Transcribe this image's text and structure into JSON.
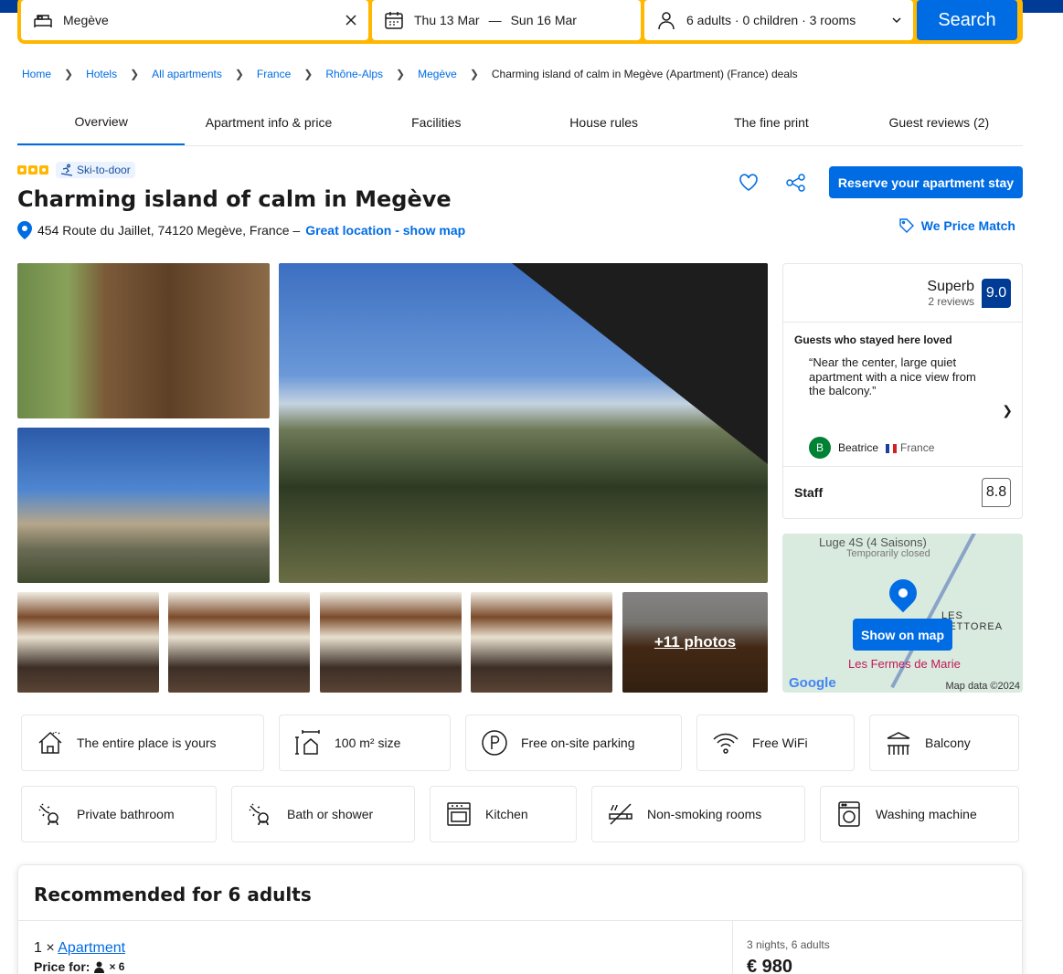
{
  "search": {
    "destination": "Megève",
    "checkin": "Thu 13 Mar",
    "dash": "—",
    "checkout": "Sun 16 Mar",
    "occupancy": "6 adults · 0 children · 3 rooms",
    "search_label": "Search"
  },
  "breadcrumb": [
    "Home",
    "Hotels",
    "All apartments",
    "France",
    "Rhône-Alps",
    "Megève"
  ],
  "breadcrumb_current": "Charming island of calm in Megève (Apartment) (France) deals",
  "tabs": [
    "Overview",
    "Apartment info & price",
    "Facilities",
    "House rules",
    "The fine print",
    "Guest reviews (2)"
  ],
  "property": {
    "badge": "Ski-to-door",
    "title": "Charming island of calm in Megève",
    "address": "454 Route du Jaillet, 74120 Megève, France –",
    "location_link": "Great location - show map",
    "reserve_label": "Reserve your apartment stay",
    "price_match": "We Price Match",
    "stars": 3
  },
  "photos": {
    "more_label": "+11 photos"
  },
  "reviews": {
    "word": "Superb",
    "count": "2 reviews",
    "score": "9.0",
    "loved_heading": "Guests who stayed here loved",
    "quote": "“Near the center, large quiet apartment with a nice view from the balcony.”",
    "reviewer_initial": "B",
    "reviewer_name": "Beatrice",
    "reviewer_country": "France",
    "staff_label": "Staff",
    "staff_score": "8.8"
  },
  "map": {
    "place1": "Luge 4S (4 Saisons)",
    "place1_status": "Temporarily closed",
    "place2": "LES PETTOREA",
    "place3": "Les Fermes de Marie",
    "google": "Google",
    "attribution": "Map data ©2024",
    "button": "Show on map"
  },
  "facilities_row1": [
    "The entire place is yours",
    "100 m² size",
    "Free on-site parking",
    "Free WiFi",
    "Balcony"
  ],
  "facilities_row2": [
    "Private bathroom",
    "Bath or shower",
    "Kitchen",
    "Non-smoking rooms",
    "Washing machine"
  ],
  "recommended": {
    "heading": "Recommended for 6 adults",
    "qty": "1 ×",
    "unit_link": "Apartment",
    "price_for": "Price for:",
    "persons": "× 6",
    "nights": "3 nights, 6 adults",
    "price": "€ 980"
  },
  "colors": {
    "brand": "#003b95",
    "accent": "#006ce4",
    "search_border": "#ffb700"
  }
}
